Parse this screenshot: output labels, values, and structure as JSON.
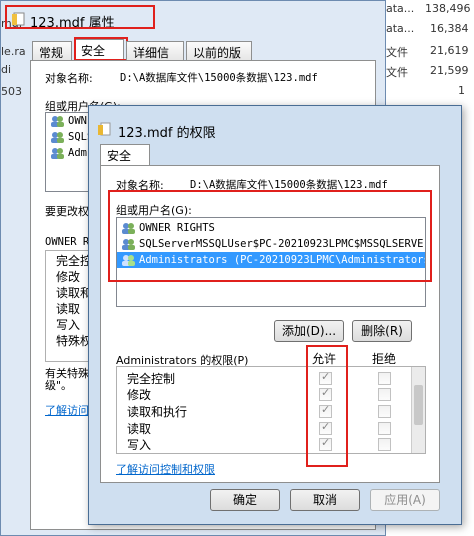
{
  "background": {
    "rows": [
      {
        "name": "ata...",
        "size": "138,496"
      },
      {
        "name": "ata...",
        "size": "16,384"
      },
      {
        "name": "文件",
        "size": "21,619"
      },
      {
        "name": "文件",
        "size": "21,599"
      },
      {
        "name": "",
        "size": "1"
      }
    ],
    "left_fragments": [
      "mdf",
      "le.ra",
      "di",
      "503"
    ]
  },
  "properties_dialog": {
    "title": "123.mdf 属性",
    "tabs": [
      "常规",
      "安全",
      "详细信息",
      "以前的版本"
    ],
    "object_name_label": "对象名称:",
    "object_path": "D:\\A数据库文件\\15000条数据\\123.mdf",
    "group_label": "组或用户名(G):",
    "users": [
      "OWNE",
      "SQLS",
      "Adm:"
    ],
    "change_perm_label": "要更改权",
    "perm_header": "OWNER RI",
    "perms": [
      "完全控",
      "修改",
      "读取和",
      "读取",
      "写入",
      "特殊权"
    ],
    "note": "有关特殊\n级\"。",
    "link": "了解访问"
  },
  "permissions_dialog": {
    "title": "123.mdf 的权限",
    "tab": "安全",
    "object_name_label": "对象名称:",
    "object_path": "D:\\A数据库文件\\15000条数据\\123.mdf",
    "group_label": "组或用户名(G):",
    "users": [
      {
        "name": "OWNER RIGHTS",
        "selected": false
      },
      {
        "name": "SQLServerMSSQLUser$PC-20210923LPMC$MSSQLSERVE...",
        "selected": false
      },
      {
        "name": "Administrators (PC-20210923LPMC\\Administrators)",
        "selected": true
      }
    ],
    "add_button": "添加(D)...",
    "remove_button": "删除(R)",
    "perm_header": "Administrators 的权限(P)",
    "allow_header": "允许",
    "deny_header": "拒绝",
    "permissions": [
      {
        "name": "完全控制",
        "allow": true,
        "deny": false
      },
      {
        "name": "修改",
        "allow": true,
        "deny": false
      },
      {
        "name": "读取和执行",
        "allow": true,
        "deny": false
      },
      {
        "name": "读取",
        "allow": true,
        "deny": false
      },
      {
        "name": "写入",
        "allow": true,
        "deny": false
      }
    ],
    "link": "了解访问控制和权限",
    "ok_button": "确定",
    "cancel_button": "取消",
    "apply_button": "应用(A)"
  },
  "colors": {
    "highlight": "#3399ff",
    "annotation_red": "#e0201c",
    "link": "#0066cc"
  }
}
